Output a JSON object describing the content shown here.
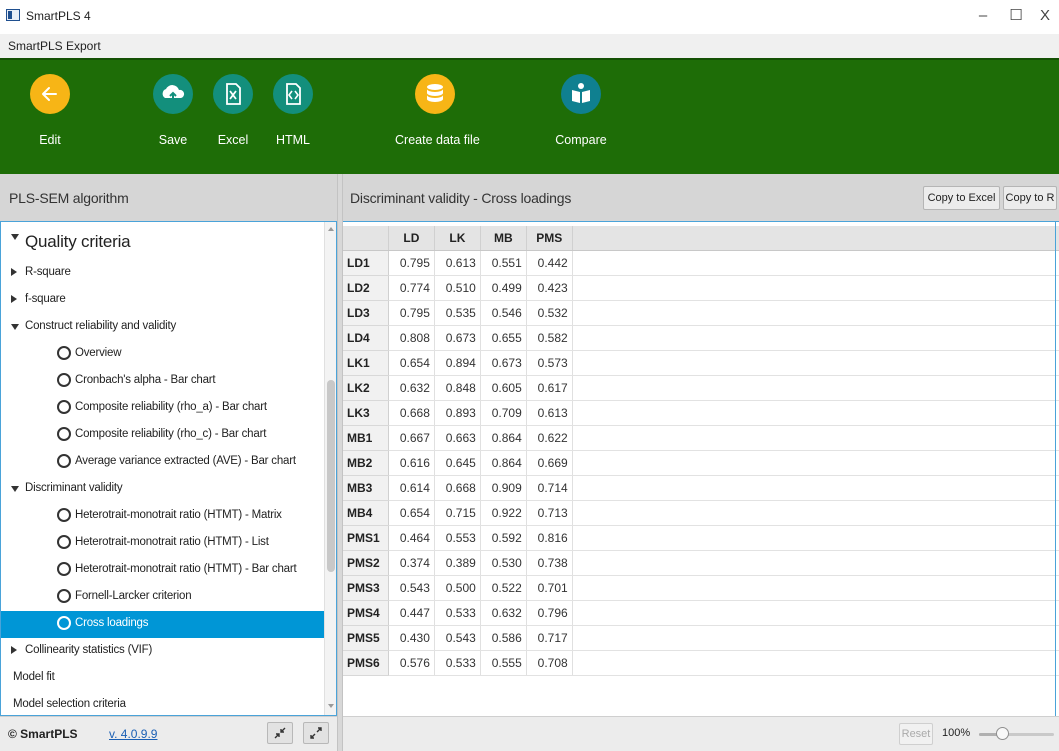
{
  "window": {
    "title": "SmartPLS 4",
    "minimize": "–",
    "maximize": "☐",
    "close": "X"
  },
  "menu": [
    "SmartPLS",
    "Export"
  ],
  "toolbar": {
    "edit": "Edit",
    "save": "Save",
    "excel": "Excel",
    "html": "HTML",
    "create_data_file": "Create data file",
    "compare": "Compare"
  },
  "left_panel": {
    "title": "PLS-SEM algorithm",
    "tree": [
      {
        "label": "Quality criteria",
        "level": 0,
        "kind": "open"
      },
      {
        "label": "R-square",
        "level": 1,
        "kind": "closed"
      },
      {
        "label": "f-square",
        "level": 1,
        "kind": "closed"
      },
      {
        "label": "Construct reliability and validity",
        "level": 1,
        "kind": "open"
      },
      {
        "label": "Overview",
        "level": 2,
        "kind": "leaf"
      },
      {
        "label": "Cronbach's alpha - Bar chart",
        "level": 2,
        "kind": "leaf"
      },
      {
        "label": "Composite reliability (rho_a) - Bar chart",
        "level": 2,
        "kind": "leaf"
      },
      {
        "label": "Composite reliability (rho_c) - Bar chart",
        "level": 2,
        "kind": "leaf"
      },
      {
        "label": "Average variance extracted (AVE) - Bar chart",
        "level": 2,
        "kind": "leaf"
      },
      {
        "label": "Discriminant validity",
        "level": 1,
        "kind": "open"
      },
      {
        "label": "Heterotrait-monotrait ratio (HTMT) - Matrix",
        "level": 2,
        "kind": "leaf"
      },
      {
        "label": "Heterotrait-monotrait ratio (HTMT) - List",
        "level": 2,
        "kind": "leaf"
      },
      {
        "label": "Heterotrait-monotrait ratio (HTMT) - Bar chart",
        "level": 2,
        "kind": "leaf"
      },
      {
        "label": "Fornell-Larcker criterion",
        "level": 2,
        "kind": "leaf"
      },
      {
        "label": "Cross loadings",
        "level": 2,
        "kind": "leaf",
        "selected": true
      },
      {
        "label": "Collinearity statistics (VIF)",
        "level": 1,
        "kind": "closed"
      },
      {
        "label": "Model fit",
        "level": 1,
        "kind": "plain"
      },
      {
        "label": "Model selection criteria",
        "level": 1,
        "kind": "plain"
      }
    ],
    "footer": {
      "copyright": "© SmartPLS",
      "version": "v. 4.0.9.9",
      "collapse_icon": "↙↗",
      "expand_icon": "↖↘"
    }
  },
  "right_panel": {
    "title": "Discriminant validity - Cross loadings",
    "copy_excel": "Copy to Excel",
    "copy_r": "Copy to R",
    "columns": [
      "LD",
      "LK",
      "MB",
      "PMS"
    ],
    "rows": [
      {
        "label": "LD1",
        "values": [
          "0.795",
          "0.613",
          "0.551",
          "0.442"
        ]
      },
      {
        "label": "LD2",
        "values": [
          "0.774",
          "0.510",
          "0.499",
          "0.423"
        ]
      },
      {
        "label": "LD3",
        "values": [
          "0.795",
          "0.535",
          "0.546",
          "0.532"
        ]
      },
      {
        "label": "LD4",
        "values": [
          "0.808",
          "0.673",
          "0.655",
          "0.582"
        ]
      },
      {
        "label": "LK1",
        "values": [
          "0.654",
          "0.894",
          "0.673",
          "0.573"
        ]
      },
      {
        "label": "LK2",
        "values": [
          "0.632",
          "0.848",
          "0.605",
          "0.617"
        ]
      },
      {
        "label": "LK3",
        "values": [
          "0.668",
          "0.893",
          "0.709",
          "0.613"
        ]
      },
      {
        "label": "MB1",
        "values": [
          "0.667",
          "0.663",
          "0.864",
          "0.622"
        ]
      },
      {
        "label": "MB2",
        "values": [
          "0.616",
          "0.645",
          "0.864",
          "0.669"
        ]
      },
      {
        "label": "MB3",
        "values": [
          "0.614",
          "0.668",
          "0.909",
          "0.714"
        ]
      },
      {
        "label": "MB4",
        "values": [
          "0.654",
          "0.715",
          "0.922",
          "0.713"
        ]
      },
      {
        "label": "PMS1",
        "values": [
          "0.464",
          "0.553",
          "0.592",
          "0.816"
        ]
      },
      {
        "label": "PMS2",
        "values": [
          "0.374",
          "0.389",
          "0.530",
          "0.738"
        ]
      },
      {
        "label": "PMS3",
        "values": [
          "0.543",
          "0.500",
          "0.522",
          "0.701"
        ]
      },
      {
        "label": "PMS4",
        "values": [
          "0.447",
          "0.533",
          "0.632",
          "0.796"
        ]
      },
      {
        "label": "PMS5",
        "values": [
          "0.430",
          "0.543",
          "0.586",
          "0.717"
        ]
      },
      {
        "label": "PMS6",
        "values": [
          "0.576",
          "0.533",
          "0.555",
          "0.708"
        ]
      }
    ],
    "footer": {
      "reset": "Reset",
      "zoom": "100%",
      "zoom_slider_fraction": 0.3
    }
  },
  "colors": {
    "toolbar_green": "#1e6d07",
    "selected_row": "#0096d6",
    "edit_yellow": "#f7b516",
    "action_teal": "#138f7c"
  },
  "icons": [
    "app-icon",
    "back-arrow-icon",
    "cloud-upload-icon",
    "excel-file-icon",
    "html-file-icon",
    "database-icon",
    "compare-icon"
  ]
}
